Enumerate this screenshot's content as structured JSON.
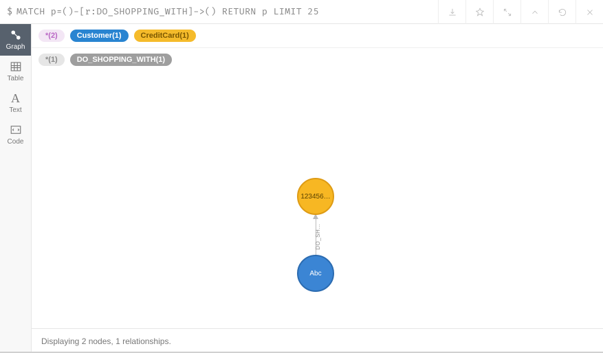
{
  "query": {
    "prompt": "$",
    "text": "MATCH p=()-[r:DO_SHOPPING_WITH]->() RETURN p LIMIT 25"
  },
  "sidebar": {
    "items": [
      {
        "label": "Graph"
      },
      {
        "label": "Table"
      },
      {
        "label": "Text"
      },
      {
        "label": "Code"
      }
    ]
  },
  "tags": {
    "nodeAll": "*(2)",
    "customer": "Customer(1)",
    "creditCard": "CreditCard(1)",
    "relAll": "*(1)",
    "relName": "DO_SHOPPING_WITH(1)"
  },
  "graph": {
    "nodes": [
      {
        "id": "creditcard",
        "label": "123456…"
      },
      {
        "id": "customer",
        "label": "Abc"
      }
    ],
    "edge": {
      "label": "DO_SH…"
    }
  },
  "footer": {
    "status": "Displaying 2 nodes, 1 relationships."
  }
}
